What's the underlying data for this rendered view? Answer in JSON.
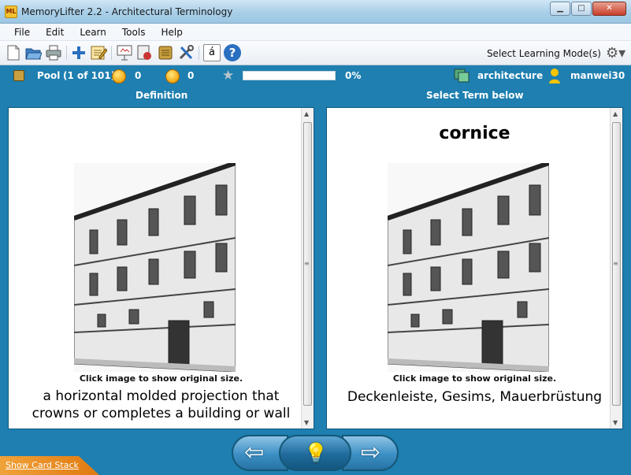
{
  "window": {
    "icon_text": "ML",
    "title": "MemoryLifter 2.2 - Architectural Terminology",
    "minimize": "▁",
    "maximize": "□",
    "close": "✕"
  },
  "menu": [
    "File",
    "Edit",
    "Learn",
    "Tools",
    "Help"
  ],
  "toolbar": {
    "icons": [
      "new-document-icon",
      "open-folder-icon",
      "print-icon",
      "add-card-icon",
      "edit-card-icon",
      "slideshow-icon",
      "card-print-icon",
      "box-icon",
      "settings-tools-icon",
      "special-character-icon",
      "help-icon"
    ],
    "special_char_glyph": "á",
    "help_glyph": "?",
    "mode_label": "Select Learning Mode(s)",
    "mode_icon": "gear-icon"
  },
  "status": {
    "pool_label": "Pool",
    "pool_count": "(1 of 101)",
    "happy_count": "0",
    "sad_count": "0",
    "progress_percent": 0,
    "progress_text": "0%",
    "dictionary_name": "architecture",
    "user_name": "manwei30"
  },
  "left_panel": {
    "heading": "Definition",
    "caption": "Click image to show original size.",
    "text_line1": "a horizontal molded projection that",
    "text_line2": "crowns or completes a building or wall"
  },
  "right_panel": {
    "heading": "Select Term below",
    "term": "cornice",
    "caption": "Click image to show original size.",
    "text": "Deckenleiste, Gesims, Mauerbrüstung"
  },
  "nav": {
    "prev_glyph": "⇦",
    "hint_glyph": "💡",
    "next_glyph": "⇨"
  },
  "show_card_stack": "Show Card Stack",
  "colors": {
    "accent": "#1e7fb0",
    "status_text": "#ffffff",
    "card_stack_tab": "#e88a20"
  }
}
